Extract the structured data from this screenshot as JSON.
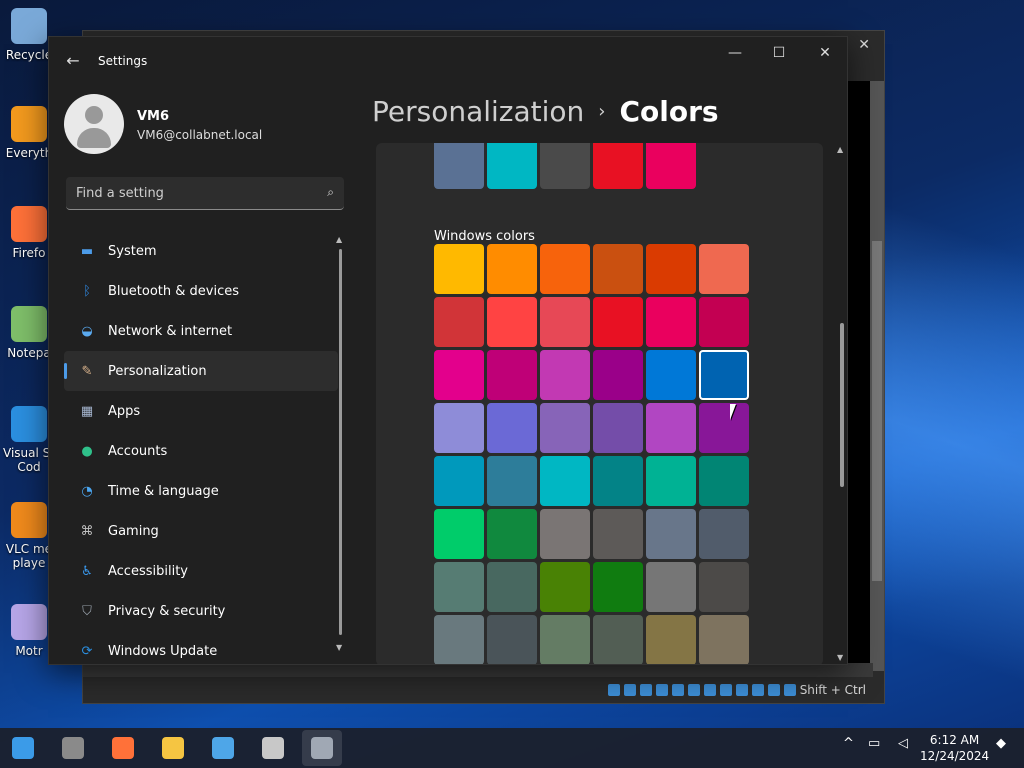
{
  "desktop": {
    "icons": [
      {
        "label": "Recycle",
        "icon": "recycle-bin-icon",
        "color": "#7aa9d8"
      },
      {
        "label": "Everyth",
        "icon": "everything-search-icon",
        "color": "#f39a1e"
      },
      {
        "label": "Firefo",
        "icon": "firefox-icon",
        "color": "#ff7139"
      },
      {
        "label": "Notepa",
        "icon": "notepad-icon",
        "color": "#7fbf6a"
      },
      {
        "label": "Visual St",
        "label2": "Cod",
        "icon": "visual-studio-code-icon",
        "color": "#2b8fe0"
      },
      {
        "label": "VLC me",
        "label2": "playe",
        "icon": "vlc-icon",
        "color": "#f08a1c"
      },
      {
        "label": "Motr",
        "icon": "motrix-icon",
        "color": "#b7a6e8"
      }
    ]
  },
  "vm_window": {
    "close_glyph": "✕",
    "status_text": "Shift + Ctrl"
  },
  "settings": {
    "app_title": "Settings",
    "back_glyph": "←",
    "controls": {
      "minimize": "—",
      "maximize": "☐",
      "close": "✕"
    },
    "user": {
      "name": "VM6",
      "email": "VM6@collabnet.local"
    },
    "search": {
      "placeholder": "Find a setting",
      "icon": "⌕"
    },
    "nav": [
      {
        "label": "System",
        "icon": "system-icon",
        "glyph": "▬",
        "color": "#4c9be8",
        "active": false
      },
      {
        "label": "Bluetooth & devices",
        "icon": "bluetooth-icon",
        "glyph": "ᛒ",
        "color": "#2f86de",
        "active": false
      },
      {
        "label": "Network & internet",
        "icon": "wifi-icon",
        "glyph": "◒",
        "color": "#5aaaf0",
        "active": false
      },
      {
        "label": "Personalization",
        "icon": "brush-icon",
        "glyph": "✎",
        "color": "#d9b38c",
        "active": true
      },
      {
        "label": "Apps",
        "icon": "apps-icon",
        "glyph": "▦",
        "color": "#a6b6d0",
        "active": false
      },
      {
        "label": "Accounts",
        "icon": "accounts-icon",
        "glyph": "●",
        "color": "#2fc08a",
        "active": false
      },
      {
        "label": "Time & language",
        "icon": "globe-clock-icon",
        "glyph": "◔",
        "color": "#4ba6f0",
        "active": false
      },
      {
        "label": "Gaming",
        "icon": "gamepad-icon",
        "glyph": "⌘",
        "color": "#bfbfbf",
        "active": false
      },
      {
        "label": "Accessibility",
        "icon": "accessibility-icon",
        "glyph": "♿",
        "color": "#3a9af0",
        "active": false
      },
      {
        "label": "Privacy & security",
        "icon": "shield-icon",
        "glyph": "⛉",
        "color": "#9aa3ad",
        "active": false
      },
      {
        "label": "Windows Update",
        "icon": "windows-update-icon",
        "glyph": "⟳",
        "color": "#2b8fe0",
        "active": false
      }
    ],
    "breadcrumb": {
      "parent": "Personalization",
      "separator": "›",
      "current": "Colors"
    },
    "recent_colors": [
      "#5a7194",
      "#00b7c3",
      "#4a4a4a",
      "#e81123",
      "#ea005e"
    ],
    "windows_colors_label": "Windows colors",
    "windows_colors": [
      [
        "#ffb900",
        "#ff8c00",
        "#f7630c",
        "#ca5010",
        "#da3b01",
        "#ef6950"
      ],
      [
        "#d13438",
        "#ff4343",
        "#e74856",
        "#e81123",
        "#ea005e",
        "#c30052"
      ],
      [
        "#e3008c",
        "#bf0077",
        "#c239b3",
        "#9a0089",
        "#0078d7",
        "#0063b1"
      ],
      [
        "#8e8cd8",
        "#6b69d6",
        "#8764b8",
        "#744da9",
        "#b146c2",
        "#881798"
      ],
      [
        "#0099bc",
        "#2d7d9a",
        "#00b7c3",
        "#038387",
        "#00b294",
        "#018574"
      ],
      [
        "#00cc6a",
        "#10893e",
        "#7a7574",
        "#5d5a58",
        "#68768a",
        "#515c6b"
      ],
      [
        "#567c73",
        "#486860",
        "#498205",
        "#107c10",
        "#767676",
        "#4c4a48"
      ],
      [
        "#69797e",
        "#4a5459",
        "#647c64",
        "#525e54",
        "#847545",
        "#7e735f"
      ]
    ],
    "selected_color": {
      "row": 2,
      "col": 5
    }
  },
  "taskbar": {
    "apps": [
      {
        "name": "start-button",
        "icon": "windows-logo-icon",
        "color": "#3b9be8",
        "active": false
      },
      {
        "name": "file-manager-button",
        "icon": "drive-icon",
        "color": "#8a8a8a",
        "active": false
      },
      {
        "name": "firefox-button",
        "icon": "firefox-icon",
        "color": "#ff7139",
        "active": false
      },
      {
        "name": "file-explorer-button",
        "icon": "folder-icon",
        "color": "#f5c542",
        "active": false
      },
      {
        "name": "visual-studio-button",
        "icon": "visual-studio-icon",
        "color": "#4ea6e8",
        "active": false
      },
      {
        "name": "sql-server-button",
        "icon": "sql-server-icon",
        "color": "#c8c8c8",
        "active": false
      },
      {
        "name": "settings-button",
        "icon": "gear-icon",
        "color": "#a0a8b4",
        "active": true
      }
    ],
    "tray": {
      "chevron": "^",
      "time": "6:12 AM",
      "date": "12/24/2024"
    }
  }
}
